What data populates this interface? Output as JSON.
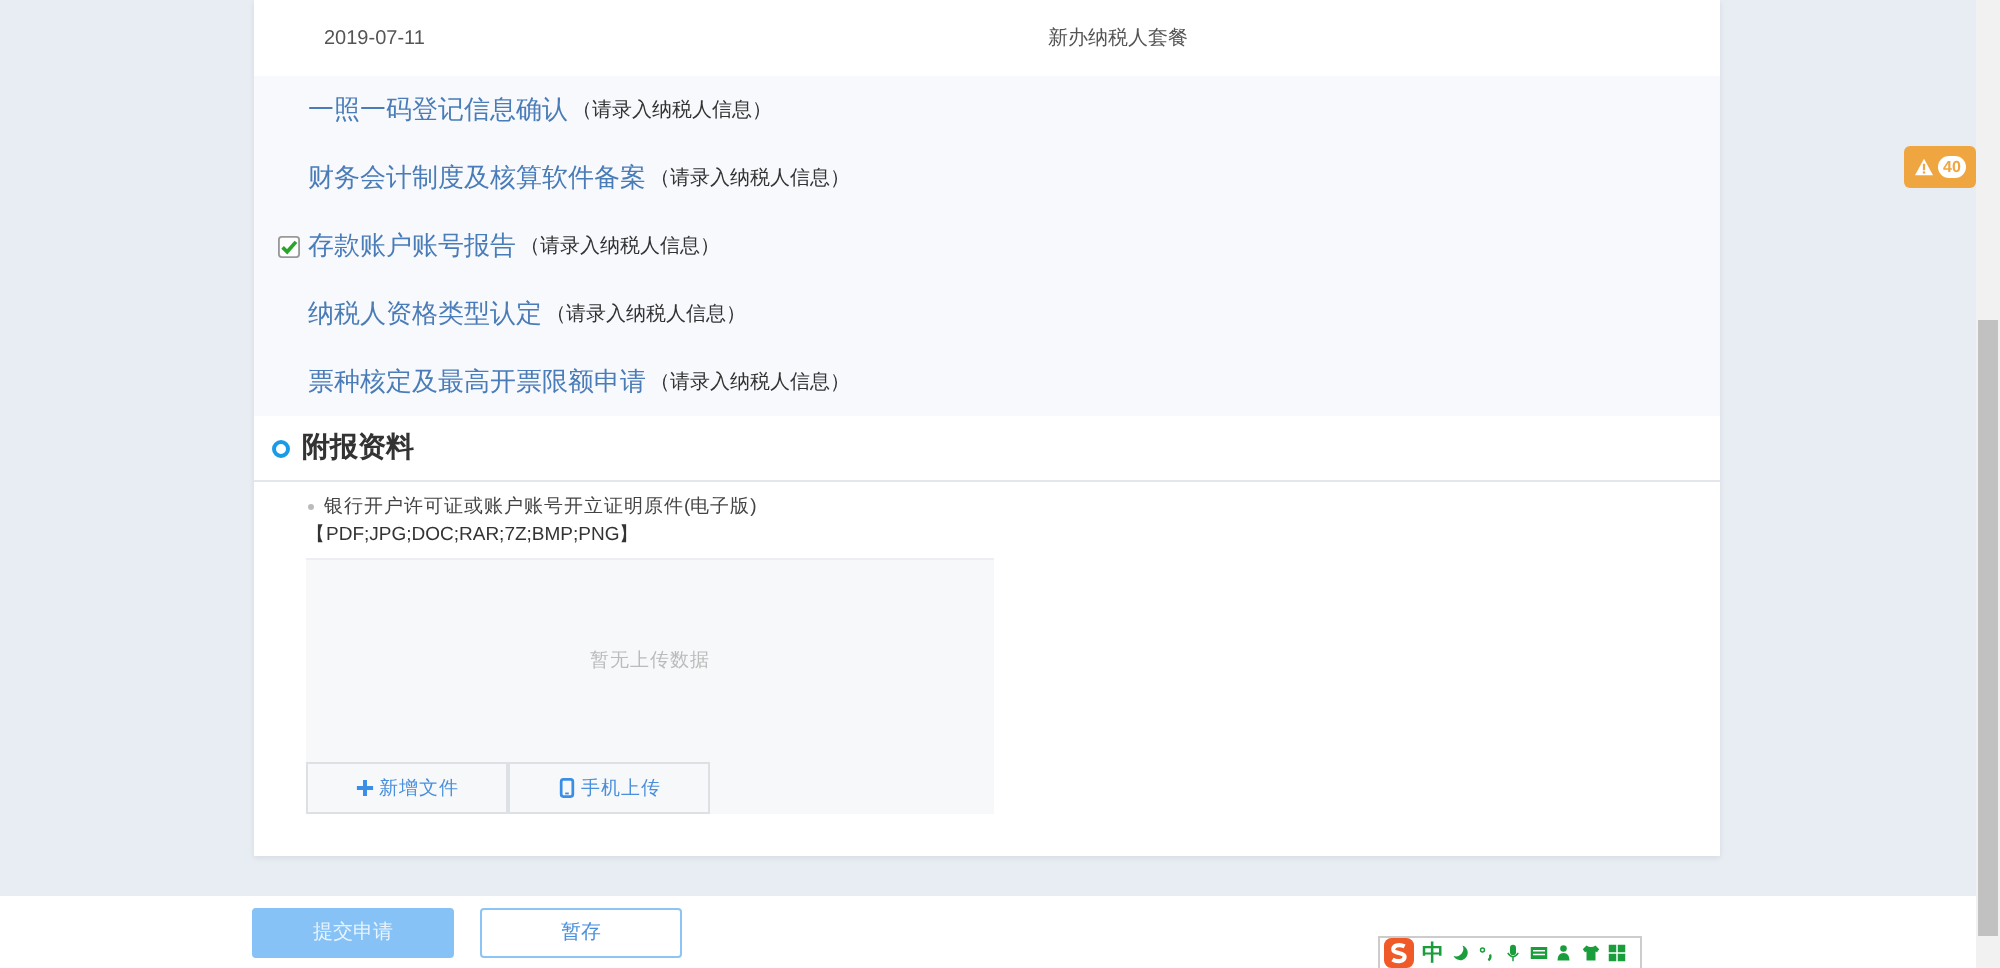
{
  "info_row": {
    "date": "2019-07-11",
    "package": "新办纳税人套餐"
  },
  "items": [
    {
      "title": "一照一码登记信息确认",
      "hint": "（请录入纳税人信息）",
      "checked": false
    },
    {
      "title": "财务会计制度及核算软件备案",
      "hint": "（请录入纳税人信息）",
      "checked": false
    },
    {
      "title": "存款账户账号报告",
      "hint": "（请录入纳税人信息）",
      "checked": true
    },
    {
      "title": "纳税人资格类型认定",
      "hint": "（请录入纳税人信息）",
      "checked": false
    },
    {
      "title": "票种核定及最高开票限额申请",
      "hint": "（请录入纳税人信息）",
      "checked": false
    }
  ],
  "attachments": {
    "title": "附报资料",
    "file_name": "银行开户许可证或账户账号开立证明原件(电子版)",
    "formats": "【PDF;JPG;DOC;RAR;7Z;BMP;PNG】",
    "empty_text": "暂无上传数据",
    "add_button": "新增文件",
    "mobile_button": "手机上传"
  },
  "warning_badge": {
    "count": "40"
  },
  "footer": {
    "submit_button": {
      "label": "提交申请",
      "disabled": true
    },
    "save_button": "暂存"
  },
  "ime_toolbar": {
    "mode": "中"
  }
}
